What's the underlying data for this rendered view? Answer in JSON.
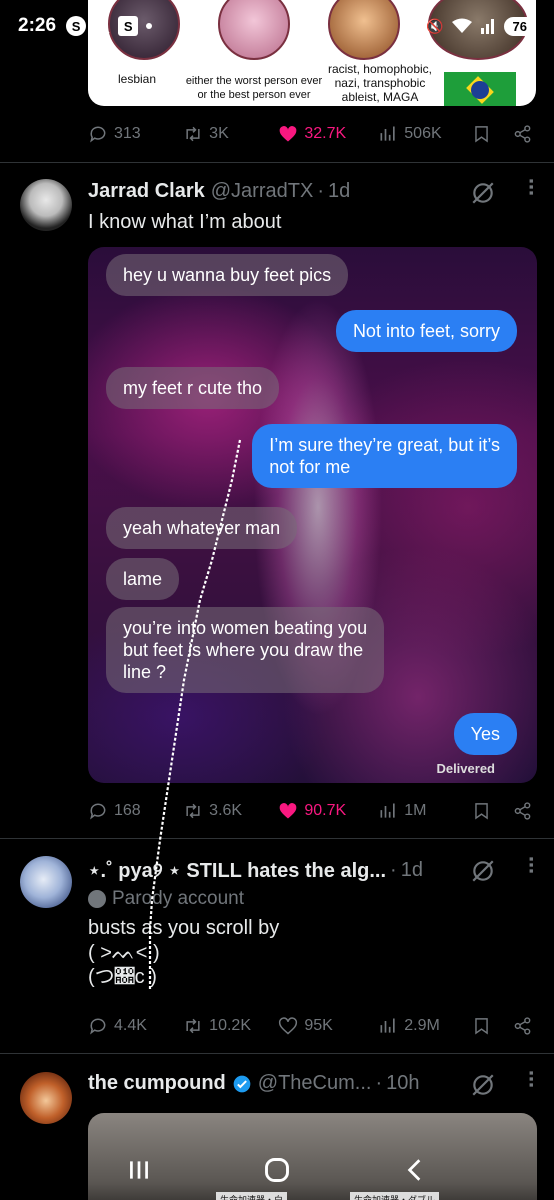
{
  "status_bar": {
    "time": "2:26",
    "battery": "76",
    "app_icons": [
      "s-icon",
      "x-icon",
      "s-square-icon",
      "dot"
    ]
  },
  "tweet1": {
    "card_labels": [
      "lesbian",
      "either the worst person ever\nor the best person ever",
      "racist, homophobic,\nnazi, transphobic\nableist, MAGA"
    ],
    "actions": {
      "replies": "313",
      "reposts": "3K",
      "likes": "32.7K",
      "views": "506K"
    }
  },
  "tweet2": {
    "name": "Jarrad Clark",
    "handle": "@JarradTX",
    "time": "1d",
    "text": "I know what I’m about",
    "chat": {
      "messages": [
        {
          "dir": "in",
          "text": "hey u wanna buy feet pics"
        },
        {
          "dir": "out",
          "text": "Not into feet, sorry"
        },
        {
          "dir": "in",
          "text": "my feet r cute tho"
        },
        {
          "dir": "out",
          "text": "I’m sure they’re great, but it’s\nnot for me"
        },
        {
          "dir": "in",
          "text": "yeah whatever man"
        },
        {
          "dir": "in",
          "text": "lame"
        },
        {
          "dir": "in",
          "text": "you’re into women beating you\nbut feet is where you draw the\nline ?"
        },
        {
          "dir": "out",
          "text": "Yes"
        }
      ],
      "delivered": "Delivered"
    },
    "actions": {
      "replies": "168",
      "reposts": "3.6K",
      "likes": "90.7K",
      "views": "1M"
    }
  },
  "tweet3": {
    "name": "⋆.˚ pya୨ ⋆ STILL hates the alg...",
    "time": "1d",
    "parody": "Parody account",
    "text": "busts as you scroll by\n( >ᨓ< )\n(つ𐨊c )",
    "actions": {
      "replies": "4.4K",
      "reposts": "10.2K",
      "likes": "95K",
      "views": "2.9M"
    }
  },
  "tweet4": {
    "name": "the cumpound",
    "handle": "@TheCum...",
    "time": "10h",
    "media_signs": [
      "生命加速器・白",
      "生命加速器・ダブル"
    ]
  },
  "colors": {
    "like": "#f91880",
    "muted": "#71767b",
    "imessage_blue": "#2b7ff3",
    "verified": "#1d9bf0"
  }
}
